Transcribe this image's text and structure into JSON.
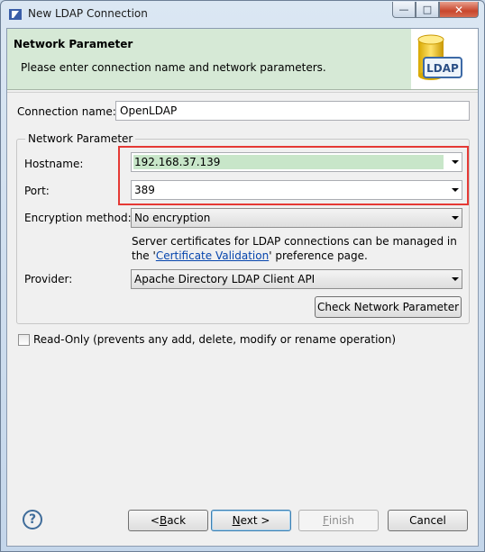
{
  "window": {
    "title": "New LDAP Connection",
    "controls": {
      "minimize": "—",
      "maximize": "□",
      "close": "✕"
    }
  },
  "banner": {
    "title": "Network Parameter",
    "description": "Please enter connection name and network parameters.",
    "image_label": "LDAP"
  },
  "connection": {
    "name_label": "Connection name:",
    "name_value": "OpenLDAP"
  },
  "network": {
    "group_label": "Network Parameter",
    "hostname_label": "Hostname:",
    "hostname_value": "192.168.37.139",
    "port_label": "Port:",
    "port_value": "389",
    "encryption_label": "Encryption method:",
    "encryption_value": "No encryption",
    "cert_note_line1": "Server certificates for LDAP connections can be managed in",
    "cert_note_prefix": "the '",
    "cert_link": "Certificate Validation",
    "cert_note_suffix": "' preference page.",
    "provider_label": "Provider:",
    "provider_value": "Apache Directory LDAP Client API",
    "check_button": "Check Network Parameter"
  },
  "readonly": {
    "label": "Read-Only (prevents any add, delete, modify or rename operation)",
    "checked": false
  },
  "footer": {
    "help_icon": "question-circle-icon",
    "back_prefix": "< ",
    "back_mnemonic": "B",
    "back_suffix": "ack",
    "next_mnemonic": "N",
    "next_suffix": "ext >",
    "finish_mnemonic": "F",
    "finish_suffix": "inish",
    "cancel_label": "Cancel"
  },
  "colors": {
    "banner_bg": "#d6e9d6",
    "highlight_border": "#e53935",
    "hostname_selection": "#c8e6c9",
    "link": "#0645ad"
  }
}
